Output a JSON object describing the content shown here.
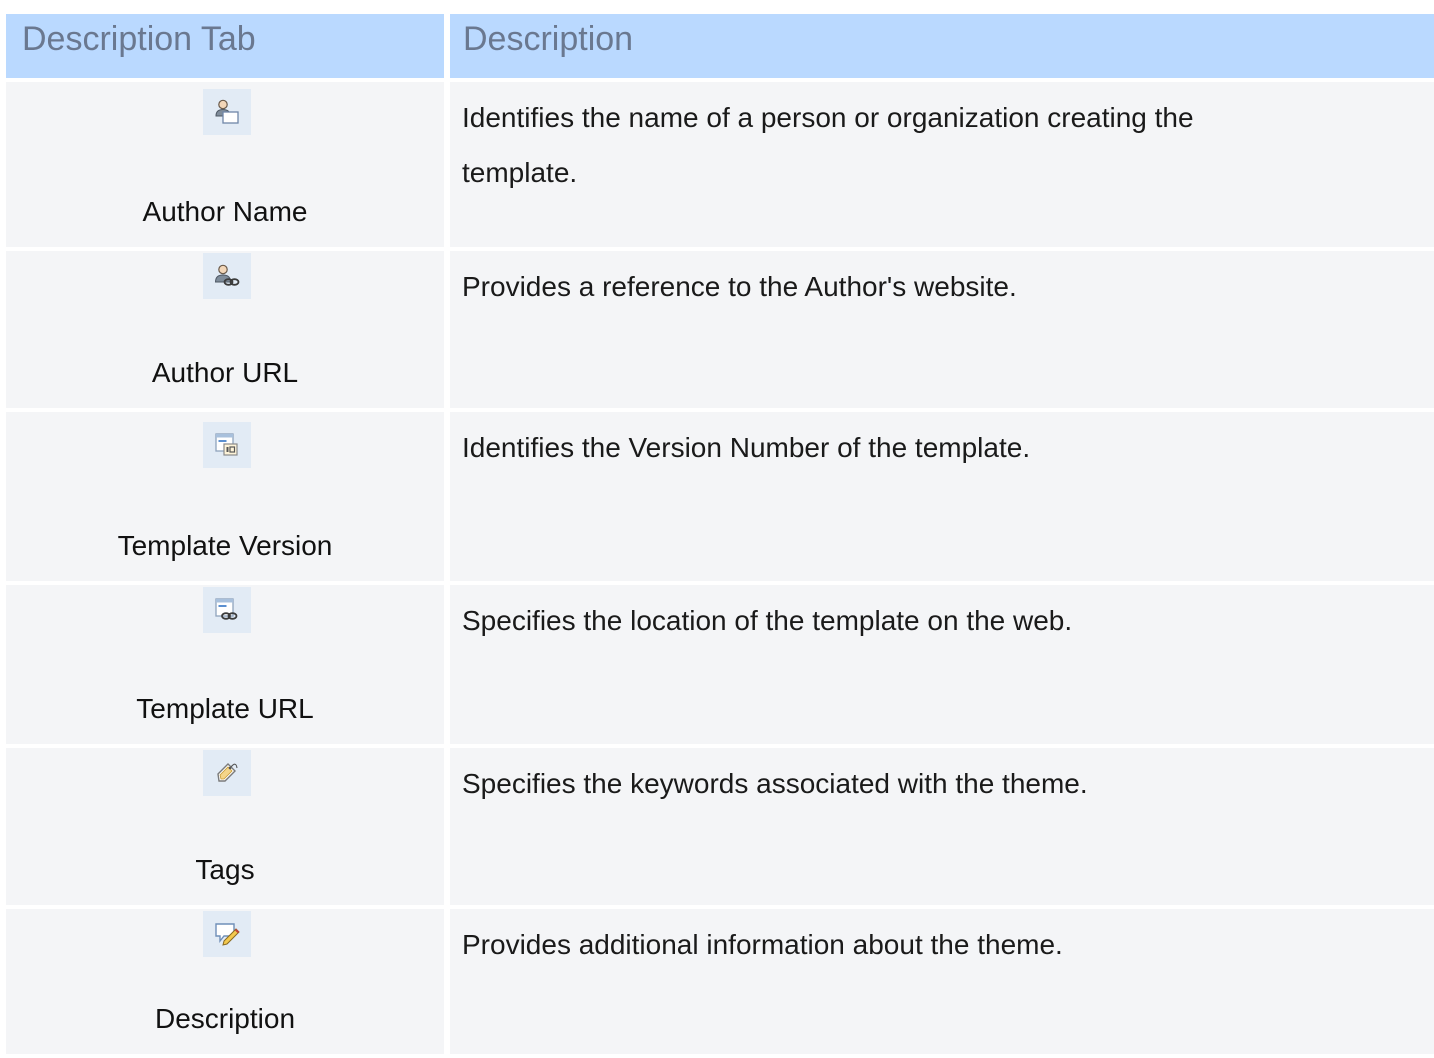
{
  "header": {
    "col1": "Description Tab",
    "col2": "Description"
  },
  "rows": [
    {
      "label": "Author Name",
      "icon": "author-name-icon",
      "description": "Identifies the name of a person or organization creating the template."
    },
    {
      "label": "Author URL",
      "icon": "author-url-icon",
      "description": "Provides a reference to the Author's website."
    },
    {
      "label": "Template Version",
      "icon": "template-version-icon",
      "description": "Identifies the Version Number of the template."
    },
    {
      "label": "Template URL",
      "icon": "template-url-icon",
      "description": "Specifies the location of the template on the web."
    },
    {
      "label": "Tags",
      "icon": "tag-icon",
      "description": "Specifies the keywords associated with the theme."
    },
    {
      "label": "Description",
      "icon": "description-edit-icon",
      "description": "Provides additional information about the theme."
    }
  ],
  "colors": {
    "header_bg": "#bad9ff",
    "header_text": "#6a7890",
    "row_bg": "#f4f5f7",
    "icon_bg": "#e2ebf5"
  }
}
